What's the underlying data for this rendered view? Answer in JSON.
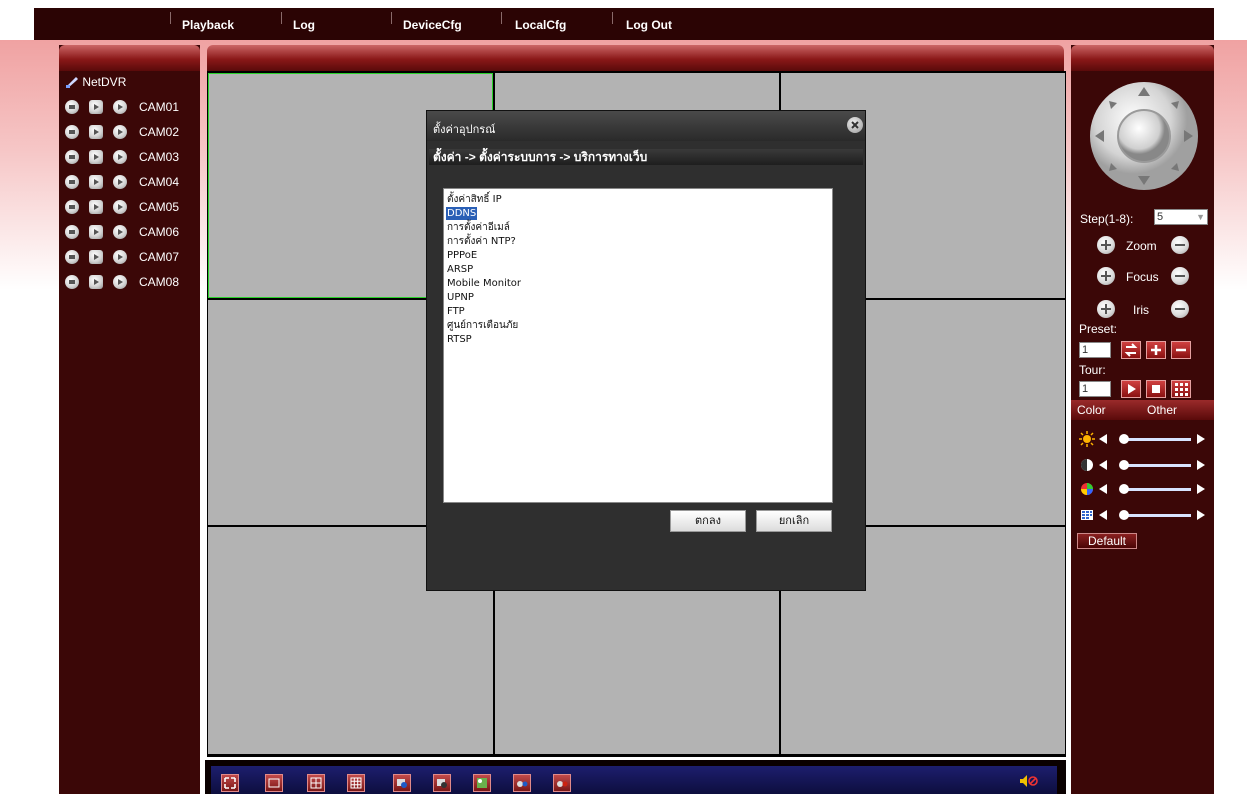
{
  "nav": {
    "items": [
      "Playback",
      "Log",
      "DeviceCfg",
      "LocalCfg",
      "Log Out"
    ]
  },
  "tree": {
    "root": "NetDVR",
    "cameras": [
      "CAM01",
      "CAM02",
      "CAM03",
      "CAM04",
      "CAM05",
      "CAM06",
      "CAM07",
      "CAM08"
    ]
  },
  "ptz": {
    "step_label": "Step(1-8):",
    "step_value": "5",
    "zoom_label": "Zoom",
    "focus_label": "Focus",
    "iris_label": "Iris",
    "preset_label": "Preset:",
    "preset_value": "1",
    "tour_label": "Tour:",
    "tour_value": "1"
  },
  "color": {
    "tab_color": "Color",
    "tab_other": "Other",
    "default_label": "Default"
  },
  "dialog": {
    "title": "ตั้งค่าอุปกรณ์",
    "breadcrumb": "ตั้งค่า -> ตั้งค่าระบบการ -> บริการทางเว็บ",
    "items": [
      "ตั้งค่าสิทธิ์ IP",
      "DDNS",
      "การตั้งค่าอีเมล์",
      "การตั้งค่า NTP?",
      "PPPoE",
      "ARSP",
      "Mobile Monitor",
      "UPNP",
      "FTP",
      "ศูนย์การเตือนภัย",
      "RTSP"
    ],
    "selected_index": 1,
    "ok_label": "ตกลง",
    "cancel_label": "ยกเลิก"
  },
  "colors": {
    "panel": "#3b0707",
    "accent": "#2bd12b",
    "selection": "#2a5fb6"
  }
}
